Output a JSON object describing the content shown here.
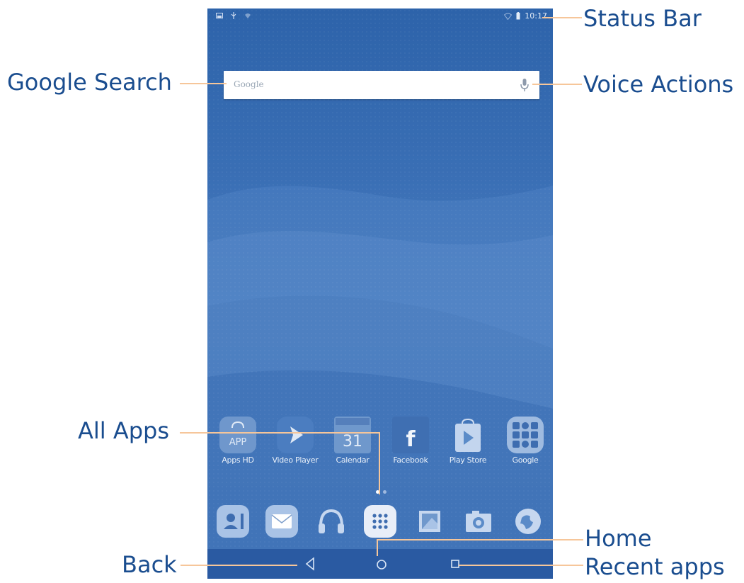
{
  "status_bar": {
    "time": "10:17"
  },
  "search": {
    "logo_text": "Google"
  },
  "apps": [
    {
      "label": "Apps HD",
      "icon": "app-store-icon",
      "badge": "APP"
    },
    {
      "label": "Video Player",
      "icon": "play-icon"
    },
    {
      "label": "Calendar",
      "icon": "calendar-icon",
      "badge": "31"
    },
    {
      "label": "Facebook",
      "icon": "facebook-icon",
      "badge": "f"
    },
    {
      "label": "Play Store",
      "icon": "play-store-icon"
    },
    {
      "label": "Google",
      "icon": "google-folder-icon"
    }
  ],
  "pager": {
    "pages": 2,
    "current": 1
  },
  "dock": [
    {
      "icon": "contacts-icon"
    },
    {
      "icon": "email-icon"
    },
    {
      "icon": "music-icon"
    },
    {
      "icon": "all-apps-icon"
    },
    {
      "icon": "gallery-icon"
    },
    {
      "icon": "camera-icon"
    },
    {
      "icon": "browser-icon"
    }
  ],
  "navigation": {
    "back": "back-icon",
    "home": "home-icon",
    "recent": "recent-apps-icon"
  },
  "annotations": {
    "status_bar": "Status Bar",
    "google_search": "Google Search",
    "voice_actions": "Voice Actions",
    "all_apps": "All Apps",
    "home": "Home",
    "back": "Back",
    "recent_apps": "Recent apps"
  },
  "colors": {
    "screen_bg": "#3a6fb5",
    "annotation_text": "#1a4d8f",
    "leader_line": "#f6c69a",
    "navbar": "#2a5aa2"
  }
}
